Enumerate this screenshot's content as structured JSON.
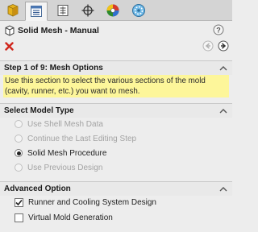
{
  "tabs": [
    {
      "icon": "featuremanager-icon"
    },
    {
      "icon": "property-manager-icon"
    },
    {
      "icon": "configuration-manager-icon"
    },
    {
      "icon": "dimxpert-icon"
    },
    {
      "icon": "display-manager-icon"
    },
    {
      "icon": "plastics-manager-icon"
    }
  ],
  "header": {
    "title": "Solid Mesh - Manual"
  },
  "step": {
    "title": "Step 1 of 9: Mesh Options",
    "note": "Use this section to select the various sections of the mold (cavity, runner, etc.) you want to mesh."
  },
  "model_type": {
    "title": "Select Model Type",
    "options": [
      {
        "label": "Use Shell Mesh Data",
        "enabled": false,
        "selected": false
      },
      {
        "label": "Continue the Last Editing Step",
        "enabled": false,
        "selected": false
      },
      {
        "label": "Solid Mesh Procedure",
        "enabled": true,
        "selected": true
      },
      {
        "label": "Use Previous Design",
        "enabled": false,
        "selected": false
      }
    ]
  },
  "advanced": {
    "title": "Advanced Option",
    "options": [
      {
        "label": "Runner and Cooling System Design",
        "checked": true
      },
      {
        "label": "Virtual Mold Generation",
        "checked": false
      }
    ]
  },
  "colors": {
    "note_background": "#fdf69a",
    "close_red": "#d0261c",
    "disabled_text": "#a3a3a3"
  }
}
